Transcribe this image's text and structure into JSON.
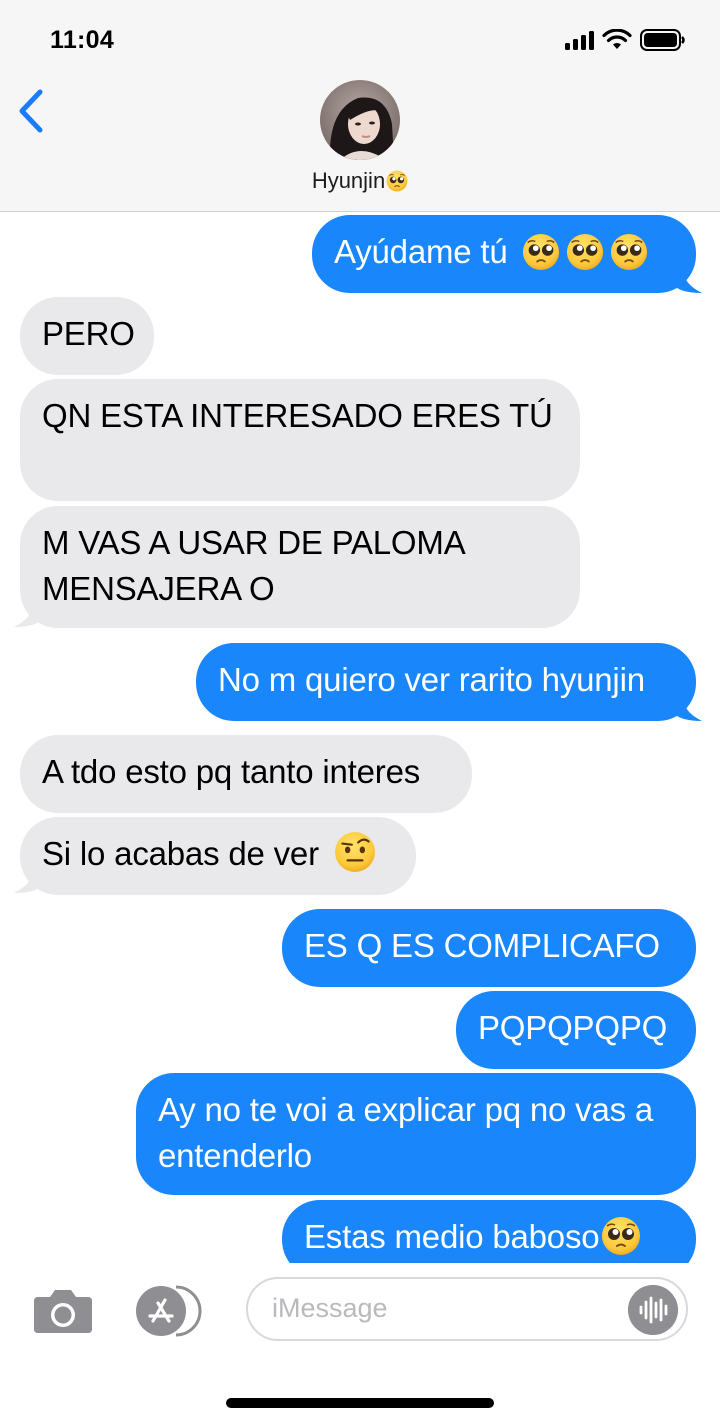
{
  "status_bar": {
    "time": "11:04"
  },
  "header": {
    "contact_name": "Hyunjin"
  },
  "messages": [
    {
      "from": "me",
      "text": "Ayúdame tú"
    },
    {
      "from": "them",
      "text": "PERO"
    },
    {
      "from": "them",
      "text": "QN ESTA INTERESADO ERES TÚ"
    },
    {
      "from": "them",
      "text": "M VAS A USAR DE PALOMA MENSAJERA O"
    },
    {
      "from": "me",
      "text": "No m quiero ver rarito hyunjin"
    },
    {
      "from": "them",
      "text": "A tdo esto pq tanto interes"
    },
    {
      "from": "them",
      "text": "Si lo acabas de ver"
    },
    {
      "from": "me",
      "text": "ES Q ES COMPLICAFO"
    },
    {
      "from": "me",
      "text": "PQPQPQPQ"
    },
    {
      "from": "me",
      "text": "Ay no te voi a explicar pq no vas a entenderlo"
    },
    {
      "from": "me",
      "text": "Estas medio baboso"
    }
  ],
  "input": {
    "placeholder": "iMessage"
  },
  "icons": [
    "back-chevron-icon",
    "camera-icon",
    "app-store-icon",
    "audio-waveform-icon",
    "pleading-face-emoji",
    "raised-eyebrow-emoji"
  ],
  "colors": {
    "sent_bubble": "#1a86fb",
    "received_bubble": "#e9e9eb",
    "accent": "#1a7cf6"
  }
}
